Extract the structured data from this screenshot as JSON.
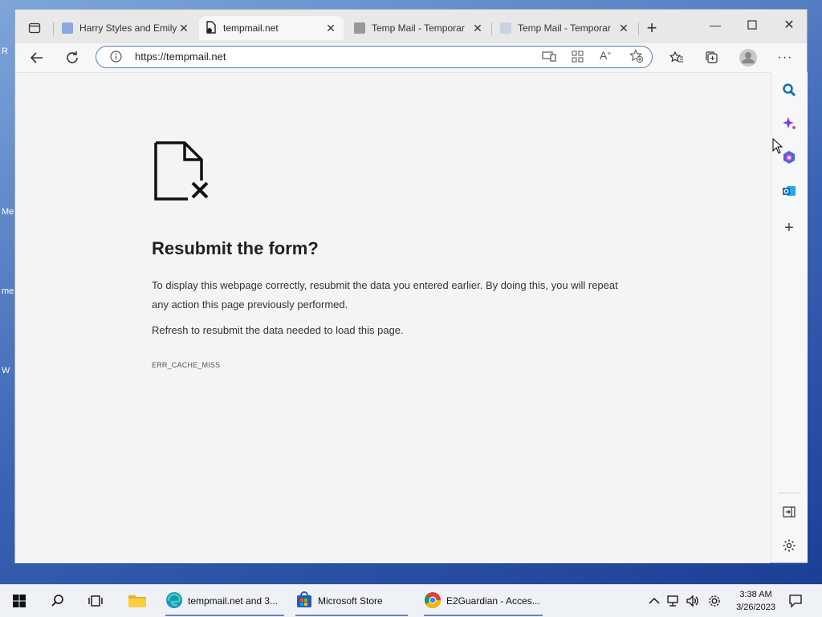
{
  "desktop": {
    "edge_labels": [
      "R",
      "Me",
      "me",
      "W"
    ]
  },
  "browser": {
    "tabs": [
      {
        "label": "Harry Styles and Emily",
        "active": false
      },
      {
        "label": "tempmail.net",
        "active": true
      },
      {
        "label": "Temp Mail - Temporar",
        "active": false
      },
      {
        "label": "Temp Mail - Temporar",
        "active": false
      }
    ],
    "url": "https://tempmail.net"
  },
  "error_page": {
    "title": "Resubmit the form?",
    "paragraph1": "To display this webpage correctly, resubmit the data you entered earlier. By doing this, you will repeat any action this page previously performed.",
    "paragraph2": "Refresh to resubmit the data needed to load this page.",
    "error_code": "ERR_CACHE_MISS"
  },
  "taskbar": {
    "apps": [
      {
        "label": "tempmail.net and 3..."
      },
      {
        "label": "Microsoft Store"
      },
      {
        "label": "E2Guardian - Acces..."
      }
    ],
    "time": "3:38 AM",
    "date": "3/26/2023"
  },
  "colors": {
    "accent": "#0f6cbd",
    "address_border": "#5a7bb3"
  }
}
